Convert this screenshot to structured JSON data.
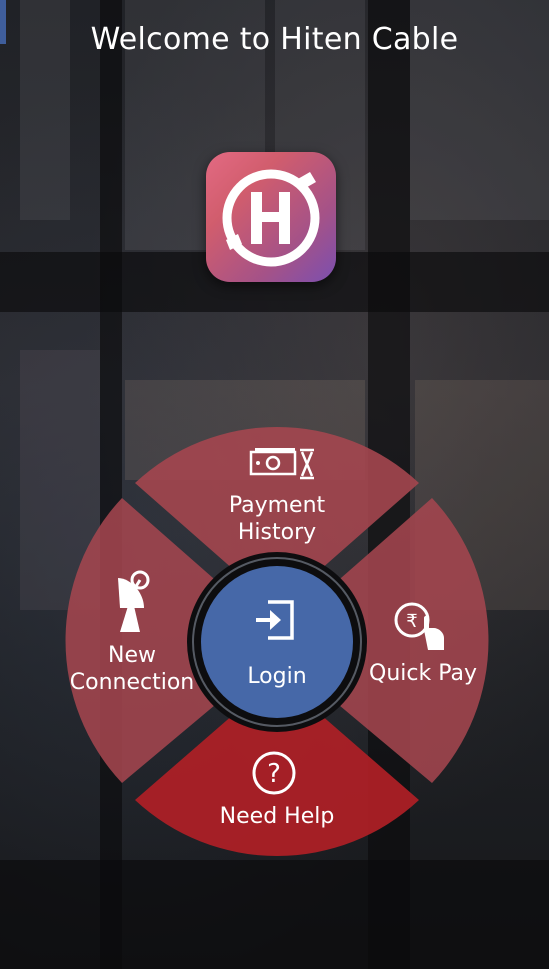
{
  "header": {
    "title": "Welcome to Hiten Cable"
  },
  "logo": {
    "icon": "hiten-cable-logo"
  },
  "menu": {
    "payment_history": {
      "line1": "Payment",
      "line2": "History",
      "icon": "money-hourglass-icon"
    },
    "new_connection": {
      "line1": "New",
      "line2": "Connection",
      "icon": "satellite-dish-icon"
    },
    "quick_pay": {
      "label": "Quick Pay",
      "icon": "rupee-tap-icon"
    },
    "need_help": {
      "label": "Need Help",
      "icon": "question-circle-icon"
    },
    "login": {
      "label": "Login",
      "icon": "login-icon"
    }
  },
  "colors": {
    "segment": "#a4464f",
    "need_help": "#b01f26",
    "login": "#4668a8",
    "ring": "#0d0d0f"
  }
}
